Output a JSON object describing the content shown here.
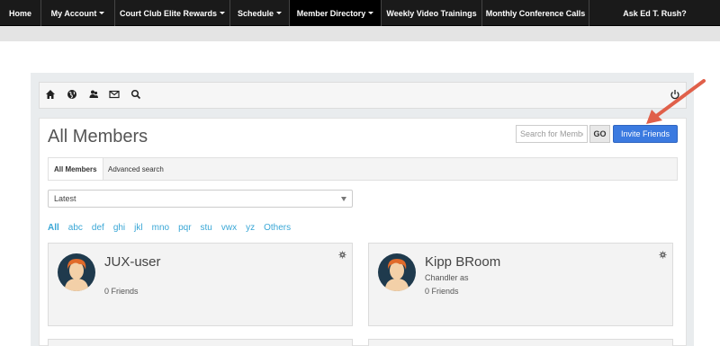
{
  "nav": {
    "items": [
      {
        "label": "Home",
        "caret": false
      },
      {
        "label": "My Account",
        "caret": true
      },
      {
        "label": "Court Club Elite Rewards",
        "caret": true
      },
      {
        "label": "Schedule",
        "caret": true
      },
      {
        "label": "Member Directory",
        "caret": true
      },
      {
        "label": "Weekly Video Trainings",
        "caret": false
      },
      {
        "label": "Monthly Conference Calls",
        "caret": false
      },
      {
        "label": "Ask Ed T. Rush?",
        "caret": false
      }
    ],
    "active_index": 4
  },
  "toolbar": {
    "icons": [
      "home-icon",
      "globe-icon",
      "users-icon",
      "envelope-icon",
      "search-icon",
      "power-icon"
    ]
  },
  "page": {
    "title": "All Members",
    "search_placeholder": "Search for Members",
    "go_label": "GO",
    "invite_label": "Invite Friends"
  },
  "tabs": [
    {
      "label": "All Members",
      "active": true
    },
    {
      "label": "Advanced search",
      "active": false
    }
  ],
  "sort": {
    "selected": "Latest"
  },
  "alphabet": [
    "All",
    "abc",
    "def",
    "ghi",
    "jkl",
    "mno",
    "pqr",
    "stu",
    "vwx",
    "yz",
    "Others"
  ],
  "members": [
    {
      "name": "JUX-user",
      "subtitle": "",
      "friends": "0 Friends"
    },
    {
      "name": "Kipp BRoom",
      "subtitle": "Chandler as",
      "friends": "0 Friends"
    }
  ],
  "colors": {
    "accent": "#3b7ae0",
    "link": "#3aa7d6",
    "annotation_arrow": "#e0604a",
    "avatar_bg": "#1f3a4d",
    "hair": "#e06a2a",
    "skin": "#f3d0a8"
  }
}
